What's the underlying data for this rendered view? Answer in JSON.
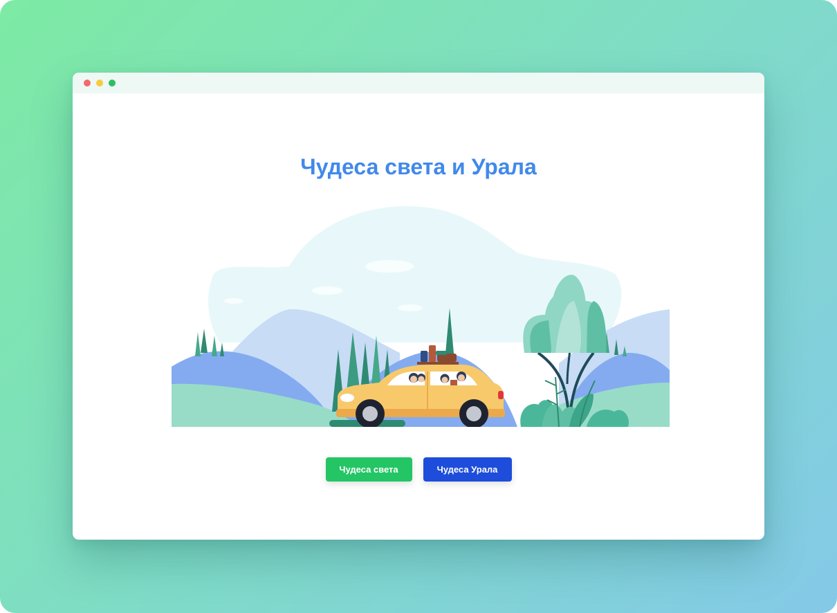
{
  "page": {
    "heading": "Чудеса света и Урала"
  },
  "buttons": {
    "world_label": "Чудеса света",
    "ural_label": "Чудеса Урала"
  },
  "illustration": {
    "subject": "car-road-trip-illustration"
  },
  "colors": {
    "heading": "#4189ea",
    "button_world": "#24c564",
    "button_ural": "#1e4ddb",
    "car": "#f8c96b"
  }
}
